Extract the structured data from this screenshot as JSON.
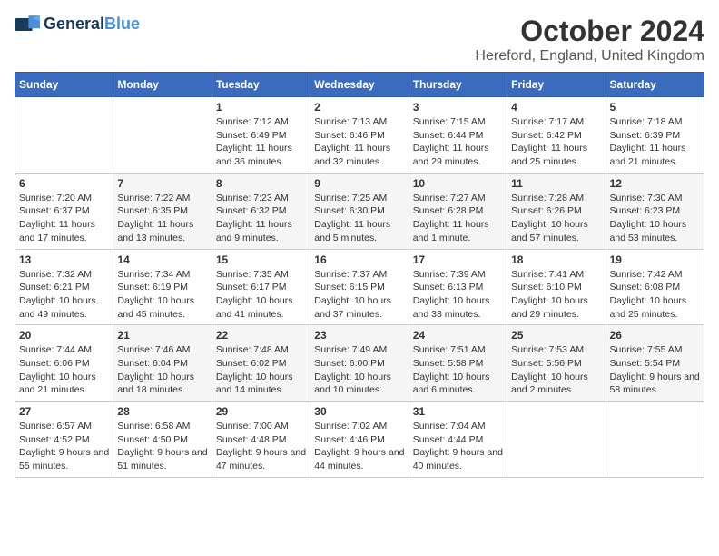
{
  "logo": {
    "general": "General",
    "blue": "Blue"
  },
  "title": "October 2024",
  "location": "Hereford, England, United Kingdom",
  "days_of_week": [
    "Sunday",
    "Monday",
    "Tuesday",
    "Wednesday",
    "Thursday",
    "Friday",
    "Saturday"
  ],
  "weeks": [
    [
      {
        "day": "",
        "info": ""
      },
      {
        "day": "",
        "info": ""
      },
      {
        "day": "1",
        "info": "Sunrise: 7:12 AM\nSunset: 6:49 PM\nDaylight: 11 hours and 36 minutes."
      },
      {
        "day": "2",
        "info": "Sunrise: 7:13 AM\nSunset: 6:46 PM\nDaylight: 11 hours and 32 minutes."
      },
      {
        "day": "3",
        "info": "Sunrise: 7:15 AM\nSunset: 6:44 PM\nDaylight: 11 hours and 29 minutes."
      },
      {
        "day": "4",
        "info": "Sunrise: 7:17 AM\nSunset: 6:42 PM\nDaylight: 11 hours and 25 minutes."
      },
      {
        "day": "5",
        "info": "Sunrise: 7:18 AM\nSunset: 6:39 PM\nDaylight: 11 hours and 21 minutes."
      }
    ],
    [
      {
        "day": "6",
        "info": "Sunrise: 7:20 AM\nSunset: 6:37 PM\nDaylight: 11 hours and 17 minutes."
      },
      {
        "day": "7",
        "info": "Sunrise: 7:22 AM\nSunset: 6:35 PM\nDaylight: 11 hours and 13 minutes."
      },
      {
        "day": "8",
        "info": "Sunrise: 7:23 AM\nSunset: 6:32 PM\nDaylight: 11 hours and 9 minutes."
      },
      {
        "day": "9",
        "info": "Sunrise: 7:25 AM\nSunset: 6:30 PM\nDaylight: 11 hours and 5 minutes."
      },
      {
        "day": "10",
        "info": "Sunrise: 7:27 AM\nSunset: 6:28 PM\nDaylight: 11 hours and 1 minute."
      },
      {
        "day": "11",
        "info": "Sunrise: 7:28 AM\nSunset: 6:26 PM\nDaylight: 10 hours and 57 minutes."
      },
      {
        "day": "12",
        "info": "Sunrise: 7:30 AM\nSunset: 6:23 PM\nDaylight: 10 hours and 53 minutes."
      }
    ],
    [
      {
        "day": "13",
        "info": "Sunrise: 7:32 AM\nSunset: 6:21 PM\nDaylight: 10 hours and 49 minutes."
      },
      {
        "day": "14",
        "info": "Sunrise: 7:34 AM\nSunset: 6:19 PM\nDaylight: 10 hours and 45 minutes."
      },
      {
        "day": "15",
        "info": "Sunrise: 7:35 AM\nSunset: 6:17 PM\nDaylight: 10 hours and 41 minutes."
      },
      {
        "day": "16",
        "info": "Sunrise: 7:37 AM\nSunset: 6:15 PM\nDaylight: 10 hours and 37 minutes."
      },
      {
        "day": "17",
        "info": "Sunrise: 7:39 AM\nSunset: 6:13 PM\nDaylight: 10 hours and 33 minutes."
      },
      {
        "day": "18",
        "info": "Sunrise: 7:41 AM\nSunset: 6:10 PM\nDaylight: 10 hours and 29 minutes."
      },
      {
        "day": "19",
        "info": "Sunrise: 7:42 AM\nSunset: 6:08 PM\nDaylight: 10 hours and 25 minutes."
      }
    ],
    [
      {
        "day": "20",
        "info": "Sunrise: 7:44 AM\nSunset: 6:06 PM\nDaylight: 10 hours and 21 minutes."
      },
      {
        "day": "21",
        "info": "Sunrise: 7:46 AM\nSunset: 6:04 PM\nDaylight: 10 hours and 18 minutes."
      },
      {
        "day": "22",
        "info": "Sunrise: 7:48 AM\nSunset: 6:02 PM\nDaylight: 10 hours and 14 minutes."
      },
      {
        "day": "23",
        "info": "Sunrise: 7:49 AM\nSunset: 6:00 PM\nDaylight: 10 hours and 10 minutes."
      },
      {
        "day": "24",
        "info": "Sunrise: 7:51 AM\nSunset: 5:58 PM\nDaylight: 10 hours and 6 minutes."
      },
      {
        "day": "25",
        "info": "Sunrise: 7:53 AM\nSunset: 5:56 PM\nDaylight: 10 hours and 2 minutes."
      },
      {
        "day": "26",
        "info": "Sunrise: 7:55 AM\nSunset: 5:54 PM\nDaylight: 9 hours and 58 minutes."
      }
    ],
    [
      {
        "day": "27",
        "info": "Sunrise: 6:57 AM\nSunset: 4:52 PM\nDaylight: 9 hours and 55 minutes."
      },
      {
        "day": "28",
        "info": "Sunrise: 6:58 AM\nSunset: 4:50 PM\nDaylight: 9 hours and 51 minutes."
      },
      {
        "day": "29",
        "info": "Sunrise: 7:00 AM\nSunset: 4:48 PM\nDaylight: 9 hours and 47 minutes."
      },
      {
        "day": "30",
        "info": "Sunrise: 7:02 AM\nSunset: 4:46 PM\nDaylight: 9 hours and 44 minutes."
      },
      {
        "day": "31",
        "info": "Sunrise: 7:04 AM\nSunset: 4:44 PM\nDaylight: 9 hours and 40 minutes."
      },
      {
        "day": "",
        "info": ""
      },
      {
        "day": "",
        "info": ""
      }
    ]
  ]
}
